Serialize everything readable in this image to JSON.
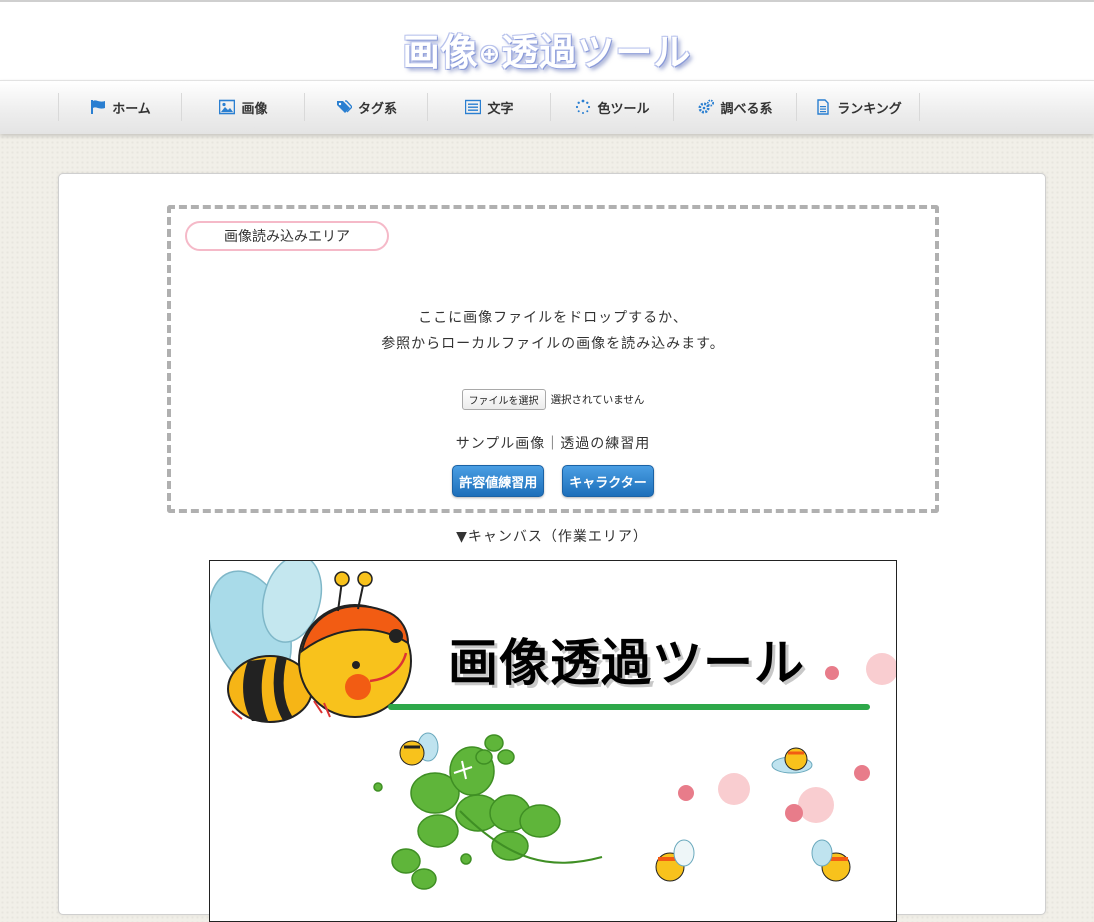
{
  "site": {
    "title_a": "画像",
    "title_icon": "search-icon",
    "title_b": "透過ツール"
  },
  "nav": [
    {
      "icon": "flag-icon",
      "label": "ホーム"
    },
    {
      "icon": "image-icon",
      "label": "画像"
    },
    {
      "icon": "tags-icon",
      "label": "タグ系"
    },
    {
      "icon": "list-icon",
      "label": "文字"
    },
    {
      "icon": "spinner-icon",
      "label": "色ツール"
    },
    {
      "icon": "gears-icon",
      "label": "調べる系"
    },
    {
      "icon": "document-icon",
      "label": "ランキング"
    }
  ],
  "drop": {
    "label": "画像読み込みエリア",
    "line1": "ここに画像ファイルをドロップするか、",
    "line2": "参照からローカルファイルの画像を読み込みます。",
    "file_button": "ファイルを選択",
    "file_status": "選択されていません",
    "sample_title": "サンプル画像｜透過の練習用",
    "sample_btn1": "許容値練習用",
    "sample_btn2": "キャラクター"
  },
  "canvas": {
    "label": "▼キャンバス（作業エリア）",
    "image_title": "画像透過ツール"
  },
  "colors": {
    "accent": "#1d6fba",
    "nav_icon": "#2a7fd1",
    "underline": "#2ea84a",
    "pink": "#f5b9c8"
  }
}
